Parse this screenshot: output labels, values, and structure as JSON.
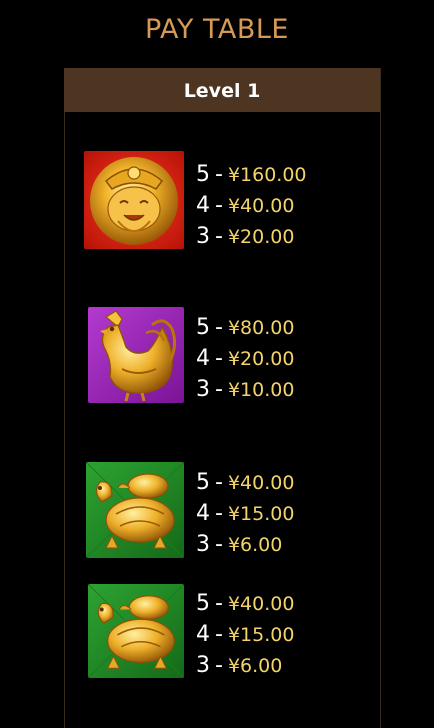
{
  "title": "PAY TABLE",
  "level_label": "Level 1",
  "symbols": [
    {
      "icon": "golden-god-of-wealth-icon",
      "background": "#d81f14",
      "pays": [
        {
          "count": "5",
          "amount": "¥160.00"
        },
        {
          "count": "4",
          "amount": "¥40.00"
        },
        {
          "count": "3",
          "amount": "¥20.00"
        }
      ]
    },
    {
      "icon": "golden-rooster-icon",
      "background": "#9b1fb8",
      "pays": [
        {
          "count": "5",
          "amount": "¥80.00"
        },
        {
          "count": "4",
          "amount": "¥20.00"
        },
        {
          "count": "3",
          "amount": "¥10.00"
        }
      ]
    },
    {
      "icon": "golden-turtle-icon",
      "background": "#1f8a24",
      "pays": [
        {
          "count": "5",
          "amount": "¥40.00"
        },
        {
          "count": "4",
          "amount": "¥15.00"
        },
        {
          "count": "3",
          "amount": "¥6.00"
        }
      ]
    },
    {
      "icon": "golden-turtle-icon",
      "background": "#1f8a24",
      "pays": [
        {
          "count": "5",
          "amount": "¥40.00"
        },
        {
          "count": "4",
          "amount": "¥15.00"
        },
        {
          "count": "3",
          "amount": "¥6.00"
        }
      ]
    }
  ]
}
